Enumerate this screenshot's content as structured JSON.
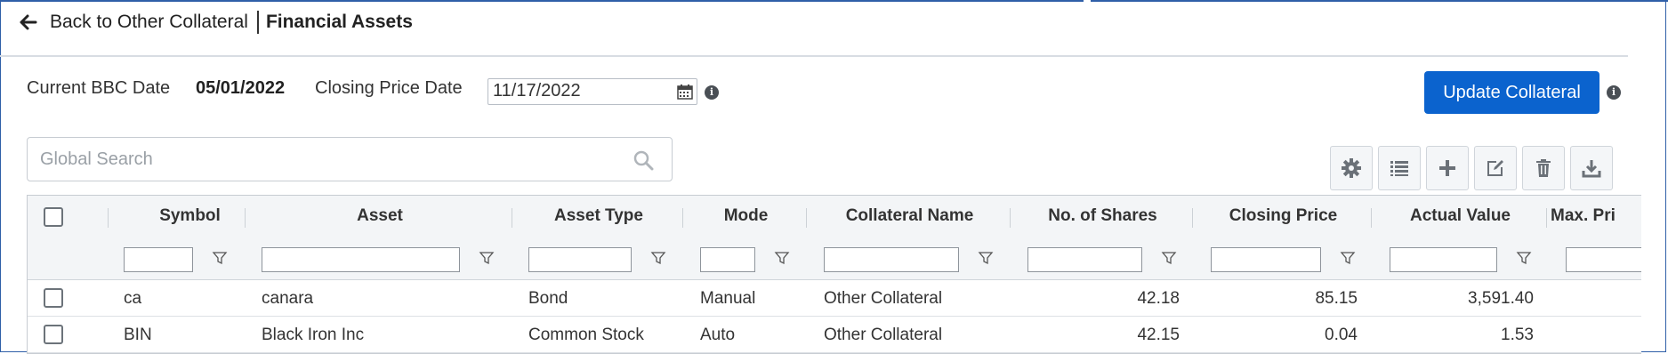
{
  "header": {
    "back_label": "Back to Other Collateral",
    "page_title": "Financial Assets"
  },
  "bbc": {
    "label": "Current BBC Date",
    "value": "05/01/2022"
  },
  "closing_date": {
    "label": "Closing Price Date",
    "value": "11/17/2022"
  },
  "update_button": "Update Collateral",
  "search": {
    "placeholder": "Global Search"
  },
  "toolbar": [
    "gear-icon",
    "list-icon",
    "plus-icon",
    "edit-icon",
    "trash-icon",
    "download-icon"
  ],
  "columns": [
    "Symbol",
    "Asset",
    "Asset Type",
    "Mode",
    "Collateral Name",
    "No. of Shares",
    "Closing Price",
    "Actual Value",
    "Max. Pri"
  ],
  "rows": [
    {
      "symbol": "ca",
      "asset": "canara",
      "asset_type": "Bond",
      "mode": "Manual",
      "collateral": "Other Collateral",
      "shares": "42.18",
      "closing": "85.15",
      "actual": "3,591.40"
    },
    {
      "symbol": "BIN",
      "asset": "Black Iron Inc",
      "asset_type": "Common Stock",
      "mode": "Auto",
      "collateral": "Other Collateral",
      "shares": "42.15",
      "closing": "0.04",
      "actual": "1.53"
    }
  ],
  "colors": {
    "primary": "#0b63ce",
    "frame": "#2f5fa8"
  }
}
